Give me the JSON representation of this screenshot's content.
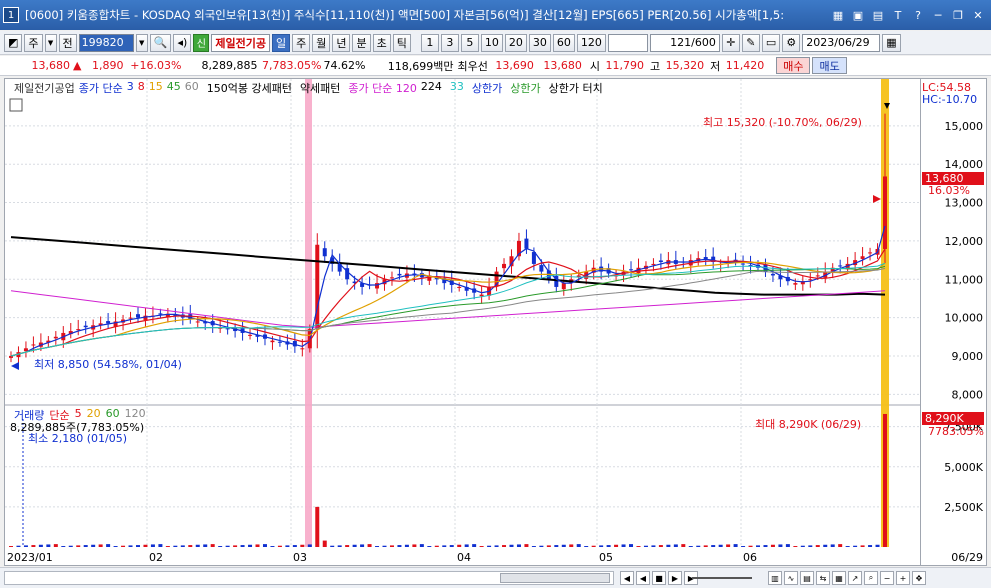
{
  "window": {
    "number": "1",
    "title": "[0600] 키움종합차트 - KOSDAQ 외국인보유[13(천)] 주식수[11,110(천)] 액면[500] 자본금[56(억)] 결산[12월] EPS[665] PER[20.56] 시가총액[1,5:",
    "icons": [
      "grid-icon",
      "window-icon",
      "memo-icon",
      "font-icon",
      "help-icon",
      "minimize-icon",
      "restore-icon",
      "close-icon"
    ]
  },
  "toolbar": {
    "ju": "주",
    "jeon": "전",
    "code": "199820",
    "stock_name": "제일전기공",
    "shin": "신",
    "period_buttons": [
      "일",
      "주",
      "월",
      "년",
      "분",
      "초",
      "틱"
    ],
    "selected_period": "일",
    "interval_buttons": [
      "1",
      "3",
      "5",
      "10",
      "20",
      "30",
      "60",
      "120"
    ],
    "count": "121",
    "count_total": "/600",
    "date": "2023/06/29"
  },
  "quote": {
    "price": "13,680",
    "change_arrow": "▲",
    "change": "1,890",
    "change_pct": "+16.03%",
    "volume": "8,289,885",
    "volume_pct": "7,783.05%",
    "turnover_pct": "74.62%",
    "amount": "118,699백만",
    "priority_label": "최우선",
    "bid1": "13,690",
    "bid2": "13,680",
    "open_label": "시",
    "open": "11,790",
    "high_label": "고",
    "high": "15,320",
    "low_label": "저",
    "low": "11,420",
    "buy_label": "매수",
    "sell_label": "매도"
  },
  "legend": {
    "stock": "제일전기공업",
    "ma_label": "종가 단순",
    "ma_periods": [
      "3",
      "8",
      "15",
      "45",
      "60"
    ],
    "ma_colors": [
      "#1030d0",
      "#e0101a",
      "#e0a000",
      "#2a9a2a",
      "#888888"
    ],
    "pattern1": "150억봉 강세패턴",
    "pattern2": "약세패턴",
    "ma120_label": "종가 단순 120",
    "ma224": "224",
    "ma33": "33",
    "upper_limit": "상한가",
    "upper_limit2": "상한가",
    "upper_touch": "상한가 터치"
  },
  "volume_legend": {
    "label": "거래량",
    "ma_label": "단순",
    "periods": [
      "5",
      "20",
      "60",
      "120"
    ],
    "colors": [
      "#e0101a",
      "#e0a000",
      "#2a9a2a",
      "#888888"
    ],
    "value": "8,289,885주(7,783.05%)"
  },
  "annotations": {
    "lc": "LC:54.58",
    "hc": "HC:-10.70",
    "high_mark": "최고 15,320 (-10.70%, 06/29)",
    "low_mark": "최저 8,850 (54.58%, 01/04)",
    "vol_max": "최대 8,290K (06/29)",
    "vol_min": "최소 2,180 (01/05)",
    "price_tag": "13,680",
    "price_tag_pct": "16.03%",
    "vol_tag": "8,290K",
    "vol_tag_pct": "7783.05%"
  },
  "chart_data": {
    "type": "candlestick",
    "price_axis_ticks": [
      "15,000",
      "14,000",
      "13,000",
      "12,000",
      "11,000",
      "10,000",
      "9,000",
      "8,000"
    ],
    "price_ylim": [
      7800,
      15700
    ],
    "volume_axis_ticks": [
      "7,500K",
      "5,000K",
      "2,500K"
    ],
    "volume_ylim": [
      0,
      8600000
    ],
    "x_ticks": [
      "2023/01",
      "02",
      "03",
      "04",
      "05",
      "06"
    ],
    "last_date": "06/29",
    "ohlc_close_approx": [
      9000,
      9100,
      9200,
      9300,
      9350,
      9400,
      9500,
      9600,
      9650,
      9700,
      9750,
      9800,
      9850,
      9850,
      9900,
      9950,
      10000,
      10000,
      10050,
      10050,
      10100,
      10100,
      10050,
      10000,
      9950,
      9900,
      9850,
      9800,
      9750,
      9700,
      9650,
      9600,
      9550,
      9500,
      9450,
      9400,
      9350,
      9300,
      9250,
      9200,
      9700,
      11900,
      11600,
      11400,
      11200,
      11000,
      10900,
      10800,
      10850,
      10900,
      11000,
      11050,
      11100,
      11150,
      11100,
      11050,
      11100,
      11000,
      10900,
      10850,
      10800,
      10700,
      10650,
      10600,
      10800,
      11200,
      11400,
      11600,
      12000,
      11800,
      11400,
      11200,
      11000,
      10800,
      10900,
      11000,
      11100,
      11200,
      11300,
      11200,
      11150,
      11100,
      11200,
      11250,
      11300,
      11350,
      11400,
      11450,
      11500,
      11400,
      11450,
      11500,
      11550,
      11500,
      11450,
      11400,
      11450,
      11500,
      11400,
      11350,
      11300,
      11200,
      11100,
      11000,
      10950,
      10900,
      10950,
      11000,
      11100,
      11200,
      11300,
      11350,
      11400,
      11500,
      11600,
      11700,
      11790,
      13680
    ],
    "ma224_approx": [
      12100,
      12050,
      12000,
      11950,
      11900,
      11850,
      11800,
      11750,
      11700,
      11650,
      11600,
      11550,
      11500,
      11450,
      11400,
      11350,
      11300,
      11250,
      11200,
      11150,
      11100,
      11050,
      11000,
      10950,
      10900,
      10850,
      10800,
      10750,
      10700,
      10650,
      10620,
      10600,
      10600,
      10600,
      10600,
      10620,
      10600
    ],
    "ma120_approx": [
      10700,
      10600,
      10500,
      10400,
      10300,
      10200,
      10100,
      10000,
      9900,
      9800,
      9750,
      9800,
      9850,
      9900,
      9950,
      10000,
      10050,
      10100,
      10150,
      10200,
      10250,
      10300,
      10350,
      10400,
      10450,
      10500,
      10550,
      10600,
      10650,
      10700
    ]
  }
}
